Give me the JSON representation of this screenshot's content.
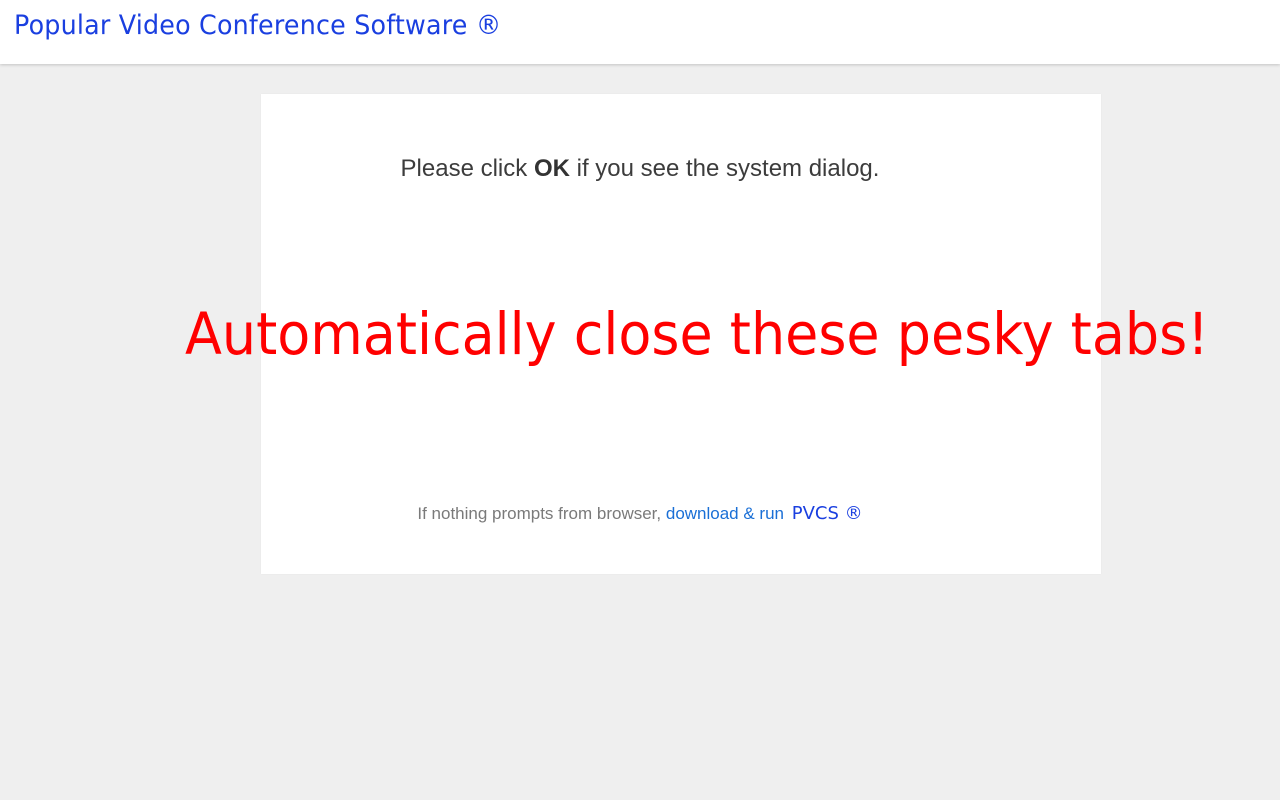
{
  "header": {
    "brand": "Popular Video Conference Software ®"
  },
  "dialog": {
    "prompt_before": "Please click ",
    "prompt_bold": "OK",
    "prompt_after": " if you see the system dialog.",
    "overlay_message": "Automatically close these pesky tabs!",
    "fallback_text": "If nothing prompts from browser, ",
    "fallback_link": "download & run",
    "fallback_brand": "PVCS ®"
  },
  "colors": {
    "brand_blue": "#1a3fe0",
    "link_blue": "#1a6fd6",
    "overlay_red": "#ff0000",
    "page_background": "#efefef"
  }
}
